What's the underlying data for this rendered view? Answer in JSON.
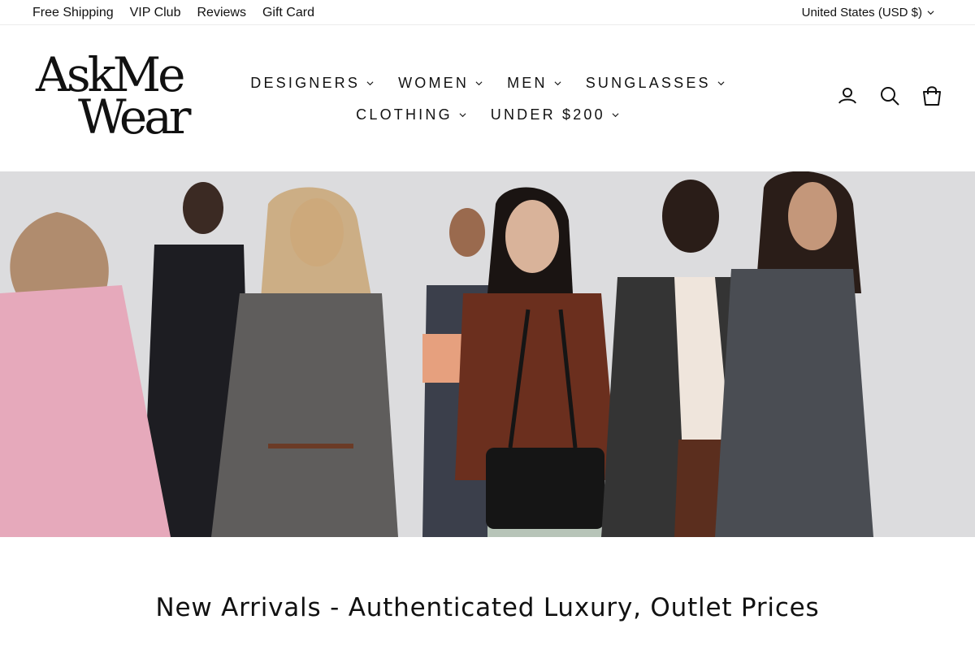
{
  "topbar": {
    "links": [
      "Free Shipping",
      "VIP Club",
      "Reviews",
      "Gift Card"
    ],
    "currency": "United States (USD $)"
  },
  "header": {
    "logo": {
      "line1": "AskMe",
      "line2": "Wear"
    },
    "nav_row1": [
      "DESIGNERS",
      "WOMEN",
      "MEN",
      "SUNGLASSES"
    ],
    "nav_row2": [
      "CLOTHING",
      "UNDER $200"
    ],
    "icons": [
      "user-icon",
      "search-icon",
      "cart-icon"
    ]
  },
  "hero": {
    "image": "runway-models-photo",
    "colors": {
      "background": "#dcdcde",
      "pink_dress": "#e6a9bb",
      "grey_knit": "#5f5d5c",
      "brown_leather": "#6b2f1e",
      "black_bag": "#151515",
      "charcoal_coat": "#343434",
      "tweed_coat": "#4a4d53"
    }
  },
  "section": {
    "title": "New Arrivals - Authenticated Luxury, Outlet Prices"
  }
}
